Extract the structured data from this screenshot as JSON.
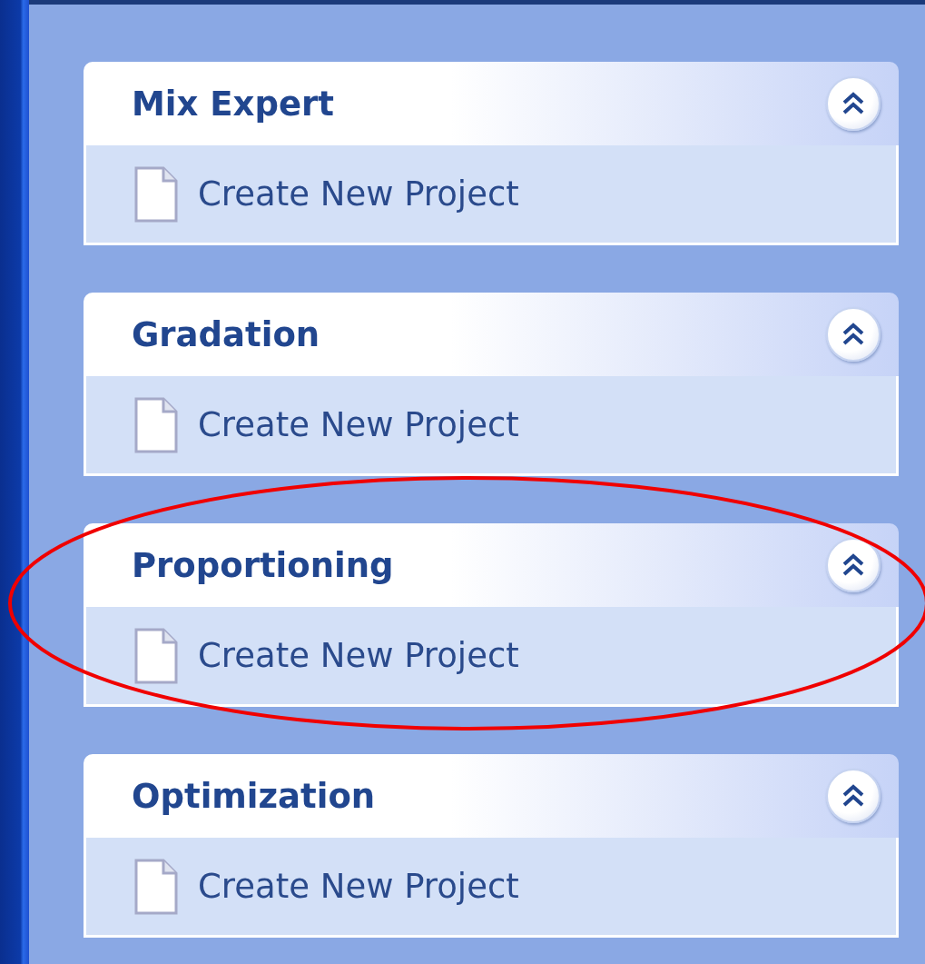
{
  "groups": [
    {
      "title": "Mix Expert",
      "expanded": true,
      "highlighted": false,
      "items": [
        {
          "label": "Create New Project"
        }
      ]
    },
    {
      "title": "Gradation",
      "expanded": true,
      "highlighted": false,
      "items": [
        {
          "label": "Create New Project"
        }
      ]
    },
    {
      "title": "Proportioning",
      "expanded": true,
      "highlighted": true,
      "items": [
        {
          "label": "Create New Project"
        }
      ]
    },
    {
      "title": "Optimization",
      "expanded": true,
      "highlighted": false,
      "items": [
        {
          "label": "Create New Project"
        }
      ]
    }
  ]
}
